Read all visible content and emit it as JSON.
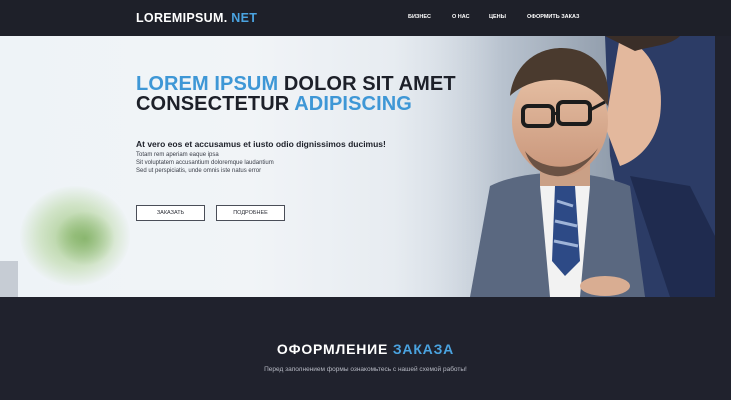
{
  "header": {
    "logo_main": "LOREMIPSUM.",
    "logo_tld": "NET",
    "nav": [
      "БИЗНЕС",
      "О НАС",
      "ЦЕНЫ",
      "ОФОРМИТЬ ЗАКАЗ"
    ]
  },
  "hero": {
    "headline_line1_blue": "LOREM IPSUM",
    "headline_line1_dark": "DOLOR SIT AMET",
    "headline_line2_dark": "CONSECTETUR",
    "headline_line2_blue": "ADIPISCING",
    "subtitle": "At vero eos et accusamus et iusto odio dignissimos ducimus!",
    "lines": [
      "Totam rem aperiam eaque ipsa",
      "Sit voluptatem accusantium doloremque laudantium",
      "Sed ut perspiciatis, unde omnis iste natus error"
    ],
    "buttons": [
      "ЗАКАЗАТЬ",
      "ПОДРОБНЕЕ"
    ]
  },
  "order": {
    "title_white": "ОФОРМЛЕНИЕ",
    "title_blue": "ЗАКАЗА",
    "subtitle": "Перед заполнением формы ознакомьтесь с нашей схемой работы!"
  },
  "colors": {
    "accent": "#3e97d6",
    "dark_background": "#20222d",
    "text_dark": "#1d2029"
  }
}
